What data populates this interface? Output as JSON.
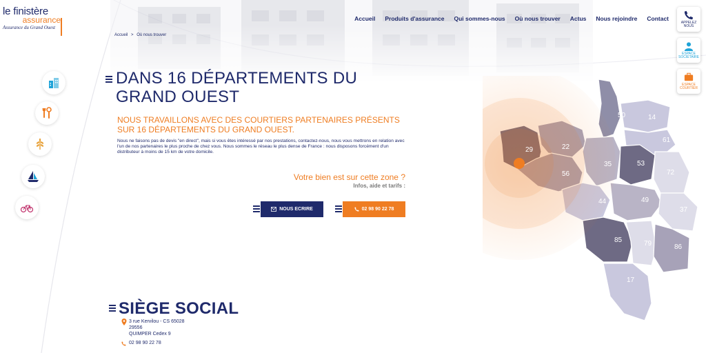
{
  "brand": {
    "line1": "le finistère",
    "line2": "assurance",
    "line3": "Assurance du Grand Ouest"
  },
  "nav": {
    "items": [
      "Accueil",
      "Produits d'assurance",
      "Qui sommes-nous",
      "Où nous trouver",
      "Actus",
      "Nous rejoindre",
      "Contact"
    ]
  },
  "side": {
    "call_label": "APPELEZ NOUS",
    "member_label": "ESPACE SOCIÉTAIRE",
    "broker_label": "ESPACE COURTIER"
  },
  "breadcrumb": {
    "home": "Accueil",
    "sep": ">",
    "current": "Où nous trouver"
  },
  "categories": [
    "building-icon",
    "tools-icon",
    "farm-icon",
    "sailboat-icon",
    "bicycle-icon"
  ],
  "hero": {
    "title_line1": "DANS 16 DÉPARTEMENTS DU",
    "title_line2": "GRAND OUEST",
    "subtitle_line1": "NOUS TRAVAILLONS AVEC DES COURTIERS PARTENAIRES PRÉSENTS",
    "subtitle_line2": "SUR 16 DÉPARTEMENTS DU GRAND OUEST.",
    "paragraph": "Nous ne faisons pas de devis \"en direct\", mais si vous êtes intéressé par nos prestations, contactez-nous, nous vous mettrons en relation avec l'un de nos partenaires le plus proche de chez vous. Nous sommes le réseau le plus dense de France : nous disposons forcément d'un distributeur à moins de 15 km de votre domicile.",
    "zone_question": "Votre bien est sur cette zone ?",
    "zone_sub": "Infos, aide et tarifs :",
    "write_button": "NOUS ECRIRE",
    "call_button": "02 98 90 22 78"
  },
  "siege": {
    "title": "SIÈGE SOCIAL",
    "address_line1": "3 rue Kervilou - CS 65028",
    "address_line2": "29556",
    "address_line3": "QUIMPER Cedex 9",
    "phone": "02 98 90 22 78"
  },
  "map": {
    "departments": [
      "50",
      "14",
      "61",
      "29",
      "22",
      "35",
      "53",
      "72",
      "56",
      "44",
      "49",
      "37",
      "85",
      "79",
      "86",
      "17"
    ]
  },
  "colors": {
    "navy": "#1f2a6b",
    "orange": "#ef7d22"
  }
}
